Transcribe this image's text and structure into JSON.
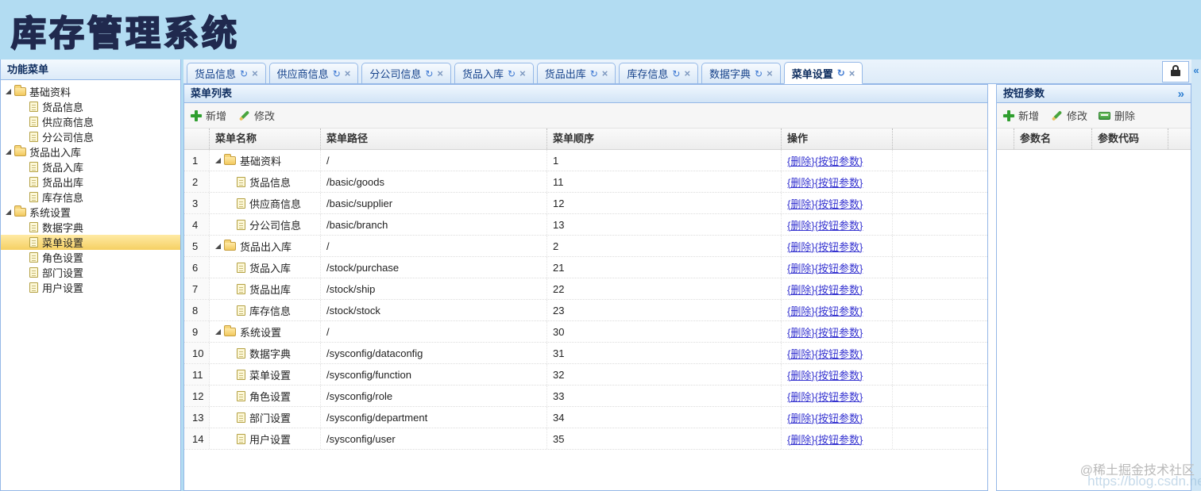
{
  "app": {
    "title": "库存管理系统"
  },
  "sidebar": {
    "title": "功能菜单",
    "groups": [
      {
        "label": "基础资料",
        "items": [
          {
            "label": "货品信息"
          },
          {
            "label": "供应商信息"
          },
          {
            "label": "分公司信息"
          }
        ]
      },
      {
        "label": "货品出入库",
        "items": [
          {
            "label": "货品入库"
          },
          {
            "label": "货品出库"
          },
          {
            "label": "库存信息"
          }
        ]
      },
      {
        "label": "系统设置",
        "items": [
          {
            "label": "数据字典"
          },
          {
            "label": "菜单设置",
            "selected": true
          },
          {
            "label": "角色设置"
          },
          {
            "label": "部门设置"
          },
          {
            "label": "用户设置"
          }
        ]
      }
    ]
  },
  "tabs": {
    "refresh_icon": "↻",
    "close_icon": "×",
    "items": [
      {
        "label": "货品信息"
      },
      {
        "label": "供应商信息"
      },
      {
        "label": "分公司信息"
      },
      {
        "label": "货品入库"
      },
      {
        "label": "货品出库"
      },
      {
        "label": "库存信息"
      },
      {
        "label": "数据字典"
      },
      {
        "label": "菜单设置",
        "active": true
      }
    ]
  },
  "rail": {
    "collapse_icon": "«"
  },
  "main": {
    "panel_title": "菜单列表",
    "toolbar": [
      {
        "name": "add",
        "label": "新增"
      },
      {
        "name": "edit",
        "label": "修改"
      }
    ],
    "table": {
      "columns": {
        "name": "菜单名称",
        "path": "菜单路径",
        "order": "菜单顺序",
        "ops": "操作"
      },
      "ops_links": [
        {
          "name": "delete-link",
          "label": "{删除}"
        },
        {
          "name": "button-params-link",
          "label": "{按钮参数}"
        }
      ],
      "rows": [
        {
          "num": "1",
          "type": "folder",
          "name": "基础资料",
          "path": "/",
          "order": "1"
        },
        {
          "num": "2",
          "type": "leaf",
          "name": "货品信息",
          "path": "/basic/goods",
          "order": "11"
        },
        {
          "num": "3",
          "type": "leaf",
          "name": "供应商信息",
          "path": "/basic/supplier",
          "order": "12"
        },
        {
          "num": "4",
          "type": "leaf",
          "name": "分公司信息",
          "path": "/basic/branch",
          "order": "13"
        },
        {
          "num": "5",
          "type": "folder",
          "name": "货品出入库",
          "path": "/",
          "order": "2"
        },
        {
          "num": "6",
          "type": "leaf",
          "name": "货品入库",
          "path": "/stock/purchase",
          "order": "21"
        },
        {
          "num": "7",
          "type": "leaf",
          "name": "货品出库",
          "path": "/stock/ship",
          "order": "22"
        },
        {
          "num": "8",
          "type": "leaf",
          "name": "库存信息",
          "path": "/stock/stock",
          "order": "23"
        },
        {
          "num": "9",
          "type": "folder",
          "name": "系统设置",
          "path": "/",
          "order": "30"
        },
        {
          "num": "10",
          "type": "leaf",
          "name": "数据字典",
          "path": "/sysconfig/dataconfig",
          "order": "31"
        },
        {
          "num": "11",
          "type": "leaf",
          "name": "菜单设置",
          "path": "/sysconfig/function",
          "order": "32"
        },
        {
          "num": "12",
          "type": "leaf",
          "name": "角色设置",
          "path": "/sysconfig/role",
          "order": "33"
        },
        {
          "num": "13",
          "type": "leaf",
          "name": "部门设置",
          "path": "/sysconfig/department",
          "order": "34"
        },
        {
          "num": "14",
          "type": "leaf",
          "name": "用户设置",
          "path": "/sysconfig/user",
          "order": "35"
        }
      ]
    }
  },
  "east": {
    "panel_title": "按钮参数",
    "collapse_icon": "»",
    "toolbar": [
      {
        "name": "add",
        "label": "新增"
      },
      {
        "name": "edit",
        "label": "修改"
      },
      {
        "name": "delete",
        "label": "删除"
      }
    ],
    "table": {
      "columns": {
        "param_name": "参数名",
        "param_code": "参数代码"
      }
    }
  },
  "watermark": {
    "community": "@稀土掘金技术社区",
    "url": "https://blog.csdn.net/"
  },
  "colors": {
    "panel_border": "#95B8E7",
    "banner_bg": "#b2dcf2",
    "title_text": "#20294e",
    "selected_tree_item": "#f5d063",
    "link": "#3533d0",
    "icon_green": "#2f9e2f"
  }
}
